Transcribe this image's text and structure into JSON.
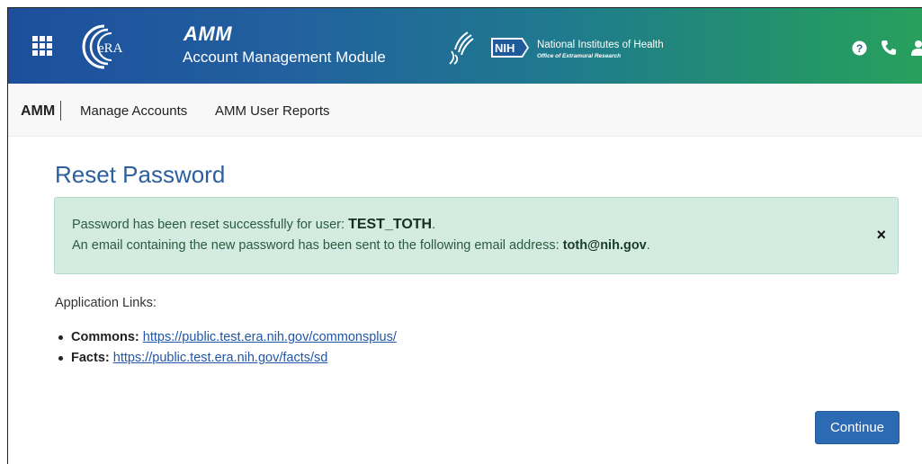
{
  "header": {
    "logo_text": "eRA",
    "app_name": "AMM",
    "app_subtitle": "Account Management Module",
    "nih_badge": "NIH",
    "nih_title": "National Institutes of Health",
    "nih_subtitle": "Office of Extramural Research",
    "icons": [
      "apps-grid-icon",
      "help-icon",
      "phone-icon",
      "user-icon"
    ],
    "gradient_colors": [
      "#1d4f9c",
      "#28a05c"
    ]
  },
  "subnav": {
    "brand": "AMM",
    "links": [
      "Manage Accounts",
      "AMM User Reports"
    ]
  },
  "main": {
    "title": "Reset Password",
    "alert": {
      "line1_prefix": "Password has been reset successfully for user: ",
      "user": "TEST_TOTH",
      "line1_suffix": ".",
      "line2_prefix": "An email containing the new password has been sent to the following email address: ",
      "email": "toth@nih.gov",
      "line2_suffix": ".",
      "close_label": "×"
    },
    "links_heading": "Application Links:",
    "links": [
      {
        "label": "Commons:",
        "url": "https://public.test.era.nih.gov/commonsplus/"
      },
      {
        "label": "Facts:",
        "url": "https://public.test.era.nih.gov/facts/sd"
      }
    ],
    "continue_label": "Continue"
  },
  "colors": {
    "accent": "#2c5f9e",
    "button": "#2d6ab4",
    "alert_bg": "#d4ebe1",
    "link": "#2156a6"
  }
}
